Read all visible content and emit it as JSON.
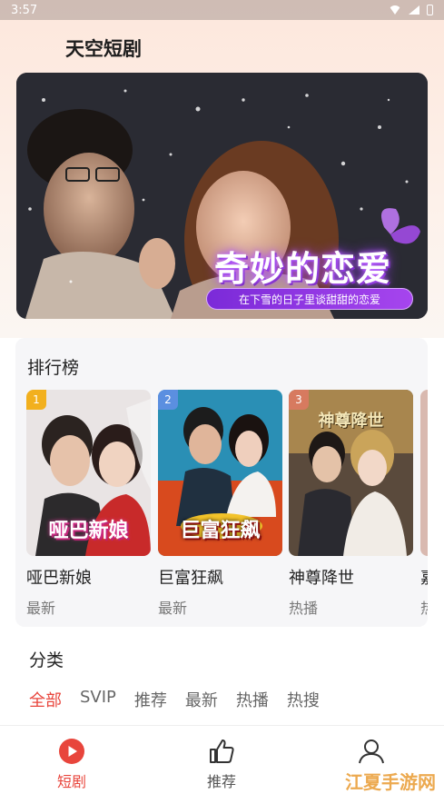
{
  "status_bar": {
    "time": "3:57"
  },
  "app_title": "天空短剧",
  "banner": {
    "title": "奇妙的恋爱",
    "subtitle": "在下雪的日子里谈甜甜的恋爱"
  },
  "ranking": {
    "title": "排行榜",
    "items": [
      {
        "rank": "1",
        "name": "哑巴新娘",
        "tag": "最新",
        "poster_text": "哑巴新娘",
        "rank_color": "#f2b01e"
      },
      {
        "rank": "2",
        "name": "巨富狂飙",
        "tag": "最新",
        "poster_text": "巨富狂飙",
        "rank_color": "#5b8fe0"
      },
      {
        "rank": "3",
        "name": "神尊降世",
        "tag": "热播",
        "poster_text": "神尊降世",
        "rank_color": "#d77a5f"
      },
      {
        "rank": "",
        "name": "嘉",
        "tag": "热",
        "poster_text": "",
        "rank_color": "#cccccc"
      }
    ]
  },
  "categories": {
    "title": "分类",
    "items": [
      "全部",
      "SVIP",
      "推荐",
      "最新",
      "热播",
      "热搜"
    ],
    "active_index": 0
  },
  "tabbar": {
    "tabs": [
      {
        "label": "短剧",
        "icon": "play-circle-icon",
        "active": true
      },
      {
        "label": "推荐",
        "icon": "thumbs-up-icon",
        "active": false
      },
      {
        "label": "",
        "icon": "user-icon",
        "active": false
      }
    ]
  },
  "watermark": "江夏手游网",
  "colors": {
    "accent": "#e8453c",
    "banner_purple": "#8a35e0"
  }
}
